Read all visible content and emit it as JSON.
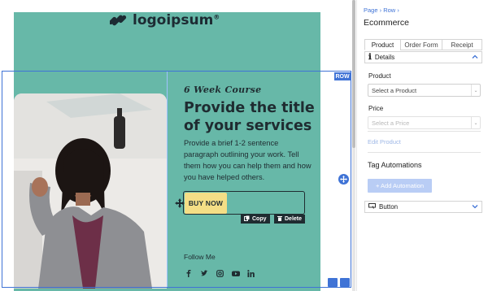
{
  "canvas": {
    "logo_text": "logoipsum",
    "logo_sup": "®",
    "row_badge": "ROW",
    "eyebrow": "6 Week Course",
    "title": "Provide the title of your services",
    "body": "Provide a brief 1-2 sentence paragraph outlining your work. Tell them how you can help them and how you have helped others.",
    "cta_label": "BUY NOW",
    "copy_label": "Copy",
    "delete_label": "Delete",
    "follow_label": "Follow Me",
    "social_icons": [
      "facebook-icon",
      "twitter-icon",
      "instagram-icon",
      "youtube-icon",
      "linkedin-icon"
    ]
  },
  "colors": {
    "page_bg": "#67b8a8",
    "cta_bg": "#f4de86",
    "accent": "#3f73d6",
    "ink": "#1f2c31"
  },
  "panel": {
    "breadcrumb": [
      "Page",
      "Row"
    ],
    "title": "Ecommerce",
    "tabs": [
      "Product",
      "Order Form",
      "Receipt"
    ],
    "active_tab": "Product",
    "details_section": "Details",
    "product_label": "Product",
    "product_select": "Select a Product",
    "price_label": "Price",
    "price_select": "Select a Price",
    "edit_product": "Edit Product",
    "tag_title": "Tag Automations",
    "add_automation": "+ Add Automation",
    "button_section": "Button"
  }
}
